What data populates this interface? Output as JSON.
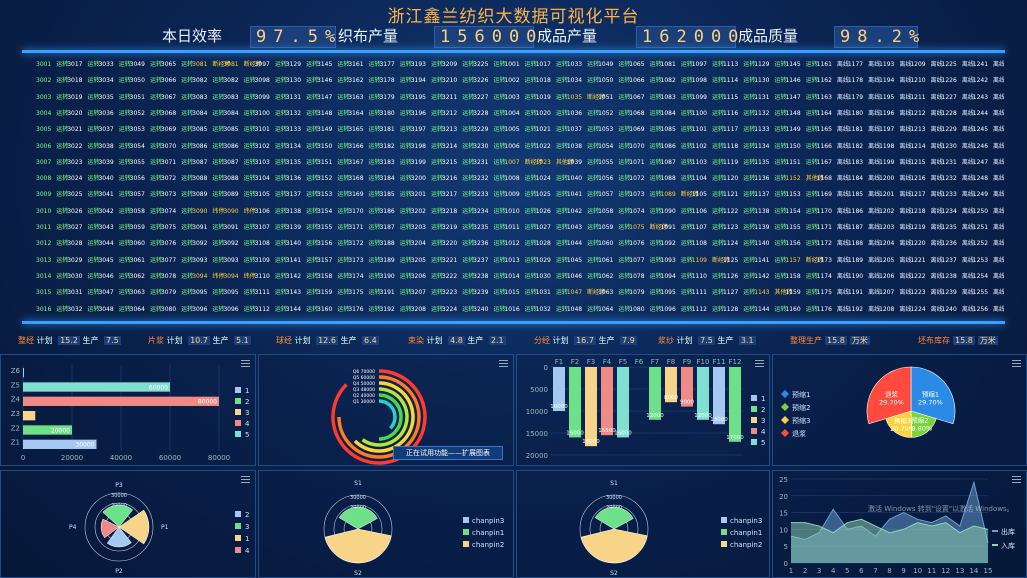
{
  "title": "浙江鑫兰纺织大数据可视化平台",
  "kpis": [
    {
      "label": "本日效率",
      "value": "97.5%"
    },
    {
      "label": "织布产量",
      "value": "156000"
    },
    {
      "label": "成品产量",
      "value": "162000"
    },
    {
      "label": "成品质量",
      "value": "98.2%"
    }
  ],
  "machine_grid_note": "columns of machine ids with status",
  "status_labels": {
    "run": "运转",
    "stop": "断经停",
    "other": "其他停",
    "stopw": "纬停",
    "offline": "离线"
  },
  "stats_bar": [
    {
      "group": "整经",
      "items": [
        {
          "k": "计划",
          "v": "15.2"
        },
        {
          "k": "生产",
          "v": "7.5"
        }
      ]
    },
    {
      "group": "片浆",
      "items": [
        {
          "k": "计划",
          "v": "10.7"
        },
        {
          "k": "生产",
          "v": "5.1"
        }
      ]
    },
    {
      "group": "球经",
      "items": [
        {
          "k": "计划",
          "v": "12.6"
        },
        {
          "k": "生产",
          "v": "6.4"
        }
      ]
    },
    {
      "group": "束染",
      "items": [
        {
          "k": "计划",
          "v": "4.8"
        },
        {
          "k": "生产",
          "v": "2.1"
        }
      ]
    },
    {
      "group": "分经",
      "items": [
        {
          "k": "计划",
          "v": "16.7"
        },
        {
          "k": "生产",
          "v": "7.9"
        }
      ]
    },
    {
      "group": "浆纱",
      "items": [
        {
          "k": "计划",
          "v": "7.5"
        },
        {
          "k": "生产",
          "v": "3.1"
        }
      ]
    },
    {
      "group": "整理生产",
      "items": [
        {
          "k": "",
          "v": "15.8"
        },
        {
          "k": "",
          "v": "万米"
        }
      ]
    },
    {
      "group": "坯布库存",
      "items": [
        {
          "k": "",
          "v": "15.8"
        },
        {
          "k": "",
          "v": "万米"
        }
      ]
    }
  ],
  "chart_data": [
    {
      "type": "bar",
      "orientation": "horizontal",
      "categories": [
        "Z1",
        "Z2",
        "Z3",
        "Z4",
        "Z5",
        "Z6"
      ],
      "values": [
        30000,
        20000,
        5000,
        80000,
        60000,
        0
      ],
      "data_labels": [
        "30000",
        "20000",
        "",
        "80000",
        "60000",
        ""
      ],
      "xlim": [
        0,
        80000
      ],
      "xticks": [
        "0",
        "20000",
        "40000",
        "60000",
        "80000"
      ],
      "legend": [
        "1",
        "2",
        "3",
        "4",
        "5"
      ],
      "colors": [
        "#a4c8f0",
        "#6de08a",
        "#f7d487",
        "#f08a86",
        "#7fe0d2"
      ]
    },
    {
      "type": "radial-bar",
      "labels": [
        "Q6 70000",
        "Q5 60000",
        "Q4 50000",
        "Q3 48000",
        "Q2 40000",
        "Q1 30000"
      ],
      "values": [
        70000,
        60000,
        50000,
        48000,
        40000,
        30000
      ]
    },
    {
      "type": "bar",
      "categories": [
        "F1",
        "F2",
        "F3",
        "F4",
        "F5",
        "F6",
        "F7",
        "F8",
        "F9",
        "F10",
        "F11",
        "F12"
      ],
      "values": [
        -10000,
        -16000,
        -18000,
        -15500,
        -16000,
        0,
        -12000,
        -8000,
        -9000,
        -12000,
        -13000,
        -17000
      ],
      "data_labels": [
        "10000",
        "16000",
        "18000",
        "15500",
        "16000",
        "",
        "12000",
        "8000",
        "9000",
        "12000",
        "13000",
        "17000"
      ],
      "ylim": [
        -20000,
        0
      ],
      "yticks": [
        "0",
        "5000",
        "10000",
        "15000",
        "20000"
      ],
      "legend": [
        "1",
        "2",
        "3",
        "4",
        "5"
      ],
      "colors": [
        "#a4c8f0",
        "#6de08a",
        "#f7d487",
        "#f08a86",
        "#7fe0d2"
      ]
    },
    {
      "type": "pie",
      "slices": [
        {
          "name": "退浆",
          "value": 29.7,
          "label": "退浆\n29.70%",
          "color": "#ff4a3d"
        },
        {
          "name": "预缩1",
          "value": 29.7,
          "label": "预缩1\n29.70%",
          "color": "#2a8ae6"
        },
        {
          "name": "预缩2",
          "value": 19.8,
          "label": "预缩2\n19.80%",
          "color": "#7ad33a"
        },
        {
          "name": "预缩3",
          "value": 20.8,
          "label": "预缩3\n20.79%",
          "color": "#ffd23a"
        }
      ],
      "legend": [
        "预缩1",
        "预缩2",
        "预缩3",
        "退浆"
      ]
    },
    {
      "type": "radar",
      "axes": [
        "P1",
        "P2",
        "P3",
        "P4"
      ],
      "rings": [
        "10000",
        "20000",
        "30000"
      ],
      "legend": [
        "2",
        "3",
        "1",
        "4"
      ],
      "colors": [
        "#a4c8f0",
        "#6de08a",
        "#f7d487",
        "#f08a86"
      ]
    },
    {
      "type": "radar",
      "axes": [
        "S1",
        "S2"
      ],
      "rings": [
        "10000",
        "20000",
        "30000"
      ],
      "legend": [
        "chanpin3",
        "chanpin1",
        "chanpin2"
      ],
      "colors": [
        "#a4c8f0",
        "#6de08a",
        "#f7d487"
      ]
    },
    {
      "type": "radar",
      "axes": [
        "S1",
        "S2"
      ],
      "rings": [
        "10000",
        "20000",
        "30000"
      ],
      "legend": [
        "chanpin3",
        "chanpin1",
        "chanpin2"
      ],
      "colors": [
        "#a4c8f0",
        "#6de08a",
        "#f7d487"
      ]
    },
    {
      "type": "area",
      "x": [
        1,
        2,
        3,
        4,
        5,
        6,
        7,
        8,
        9,
        10,
        11,
        12,
        13,
        14,
        15
      ],
      "series": [
        {
          "name": "出库",
          "values": [
            8,
            7,
            9,
            16,
            10,
            11,
            8,
            13,
            15,
            13,
            12,
            14,
            11,
            24,
            6
          ]
        },
        {
          "name": "入库",
          "values": [
            12,
            12,
            11,
            9,
            12,
            13,
            11,
            9,
            10,
            12,
            11,
            12,
            9,
            11,
            10
          ]
        }
      ],
      "ylim": [
        0,
        25
      ],
      "yticks": [
        "0",
        "5",
        "10",
        "15",
        "20",
        "25"
      ],
      "xticks": [
        "1",
        "2",
        "3",
        "4",
        "5",
        "6",
        "7",
        "8",
        "9",
        "10",
        "11",
        "12",
        "13",
        "14",
        "15"
      ]
    }
  ],
  "demo_button": "正在试用功能——扩展图表",
  "watermark": "激活 Windows 转到\"设置\"以激活 Windows。"
}
